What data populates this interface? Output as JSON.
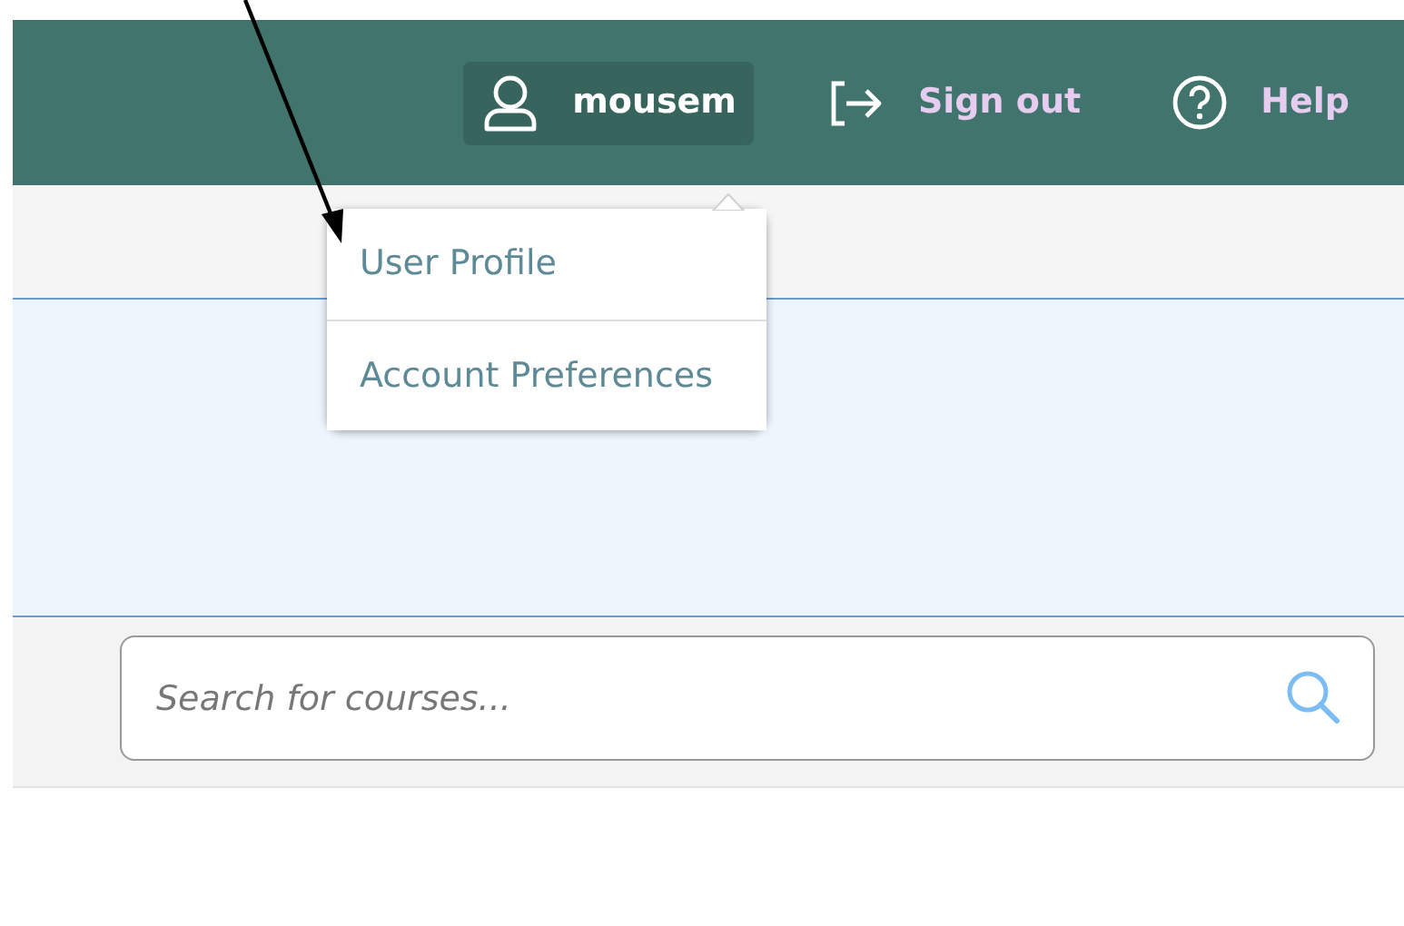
{
  "header": {
    "nav": [
      {
        "kind": "user",
        "label": "mousem",
        "expanded": true
      },
      {
        "kind": "signout",
        "label": "Sign out"
      },
      {
        "kind": "help",
        "label": "Help"
      }
    ]
  },
  "user_menu": {
    "items": [
      {
        "label": "User Profile"
      },
      {
        "label": "Account Preferences"
      }
    ]
  },
  "search": {
    "placeholder": "Search for courses..."
  }
}
